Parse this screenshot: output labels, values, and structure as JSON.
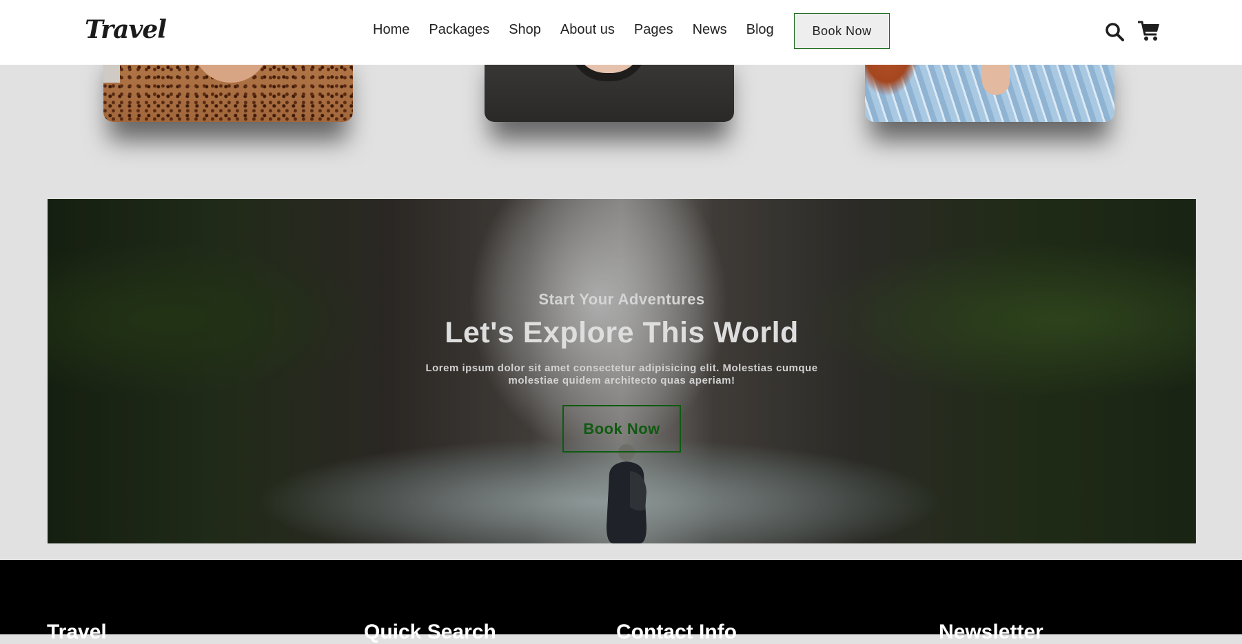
{
  "header": {
    "logo": "Travel",
    "nav": [
      "Home",
      "Packages",
      "Shop",
      "About us",
      "Pages",
      "News",
      "Blog"
    ],
    "book_button": "Book Now",
    "icons": [
      "search-icon",
      "cart-icon"
    ]
  },
  "banner": {
    "subtitle": "Start Your Adventures",
    "title": "Let's Explore This World",
    "text": "Lorem ipsum dolor sit amet consectetur adipisicing elit. Molestias cumque molestiae quidem architecto quas aperiam!",
    "button": "Book Now"
  },
  "footer": {
    "headings": [
      "Travel",
      "Quick Search",
      "Contact Info",
      "Newsletter"
    ]
  },
  "colors": {
    "accent_green": "#0f5a10",
    "header_bg": "#ffffff",
    "page_bg": "#e1e1e1",
    "footer_bg": "#000000"
  }
}
